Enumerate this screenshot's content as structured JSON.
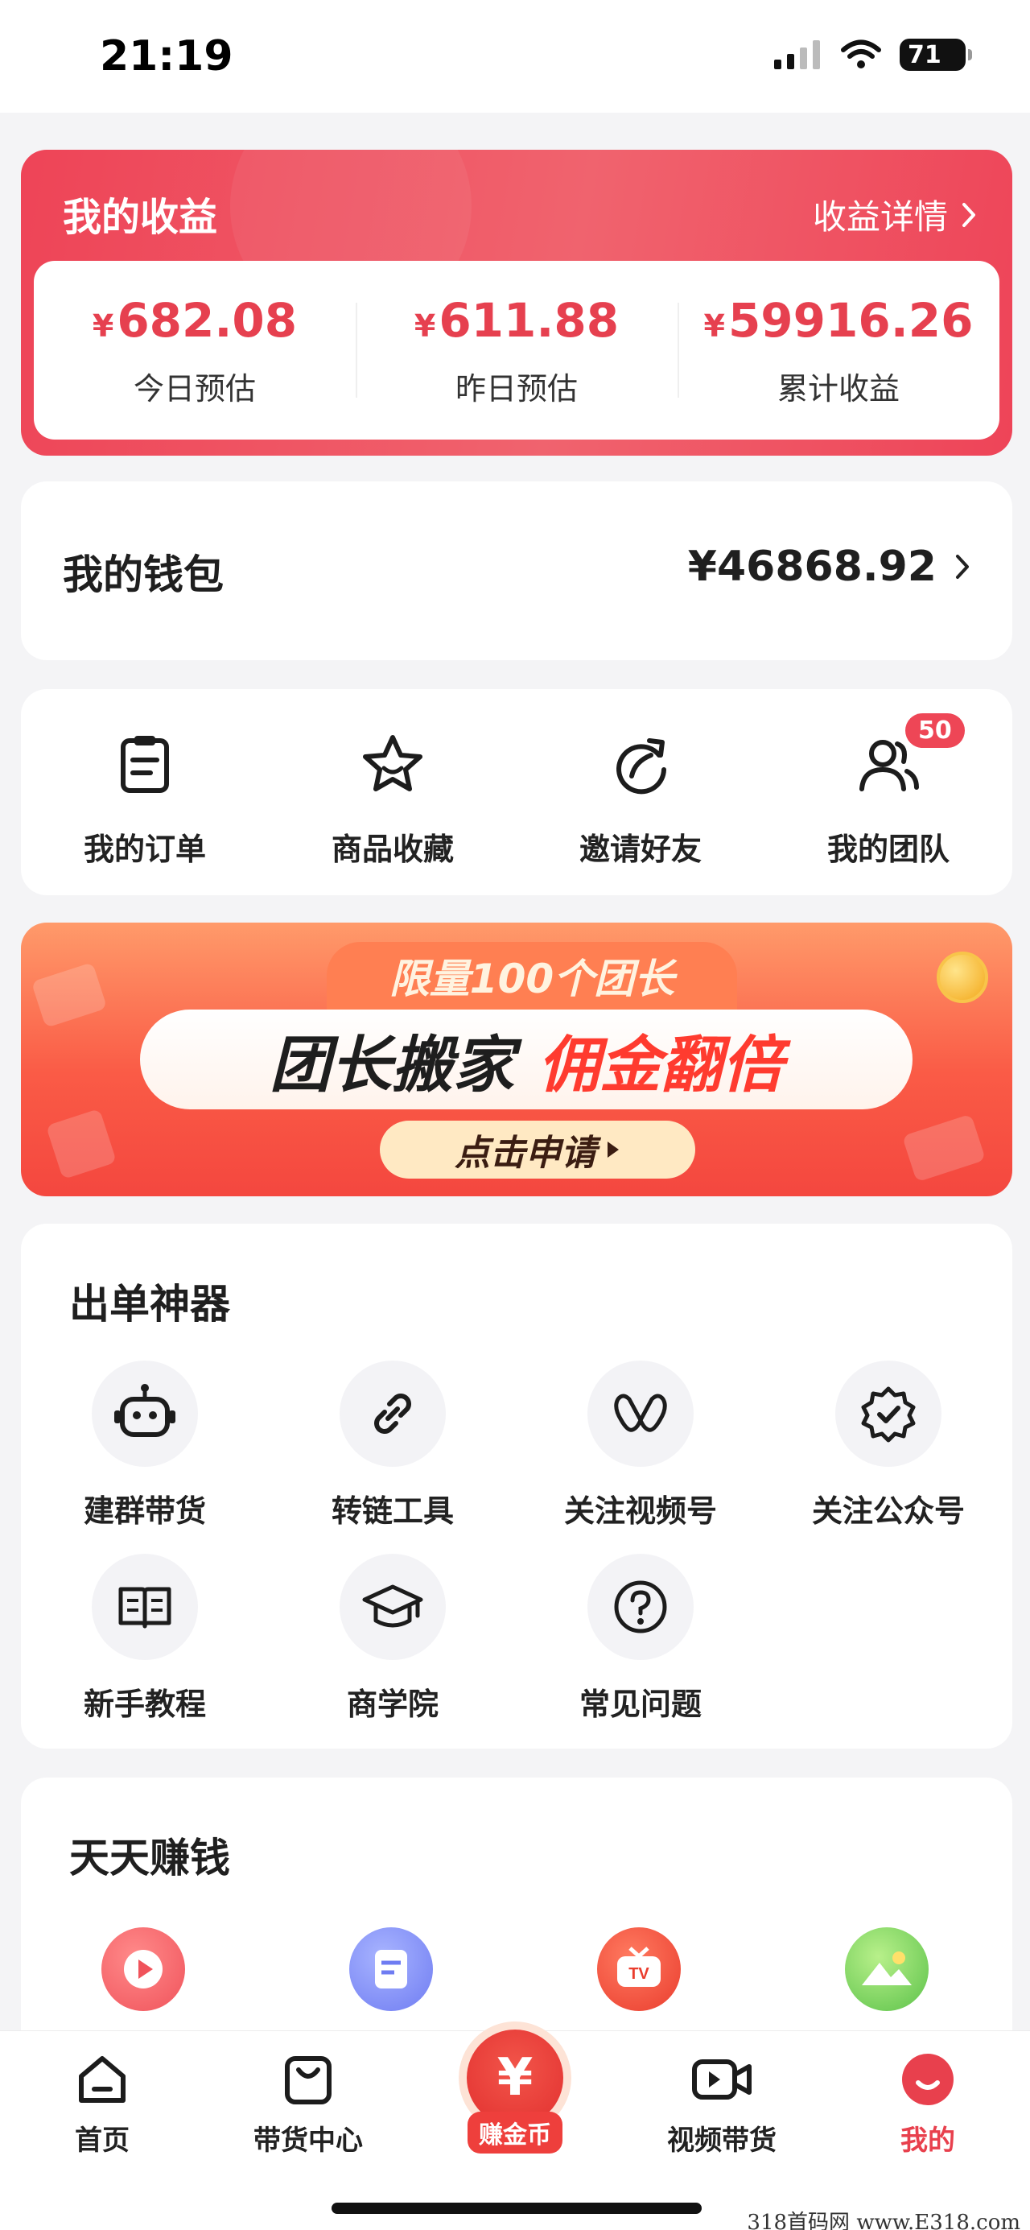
{
  "status_bar": {
    "time": "21:19",
    "battery": "71"
  },
  "earnings": {
    "title": "我的收益",
    "detail_link": "收益详情",
    "currency": "¥",
    "stats": [
      {
        "amount": "682.08",
        "label": "今日预估"
      },
      {
        "amount": "611.88",
        "label": "昨日预估"
      },
      {
        "amount": "59916.26",
        "label": "累计收益"
      }
    ]
  },
  "wallet": {
    "title": "我的钱包",
    "amount": "¥46868.92"
  },
  "quick_actions": [
    {
      "label": "我的订单",
      "icon": "order-icon"
    },
    {
      "label": "商品收藏",
      "icon": "star-icon"
    },
    {
      "label": "邀请好友",
      "icon": "invite-icon"
    },
    {
      "label": "我的团队",
      "icon": "team-icon",
      "badge": "50"
    }
  ],
  "banner": {
    "top": "限量100个团长",
    "main_a": "团长搬家",
    "main_b": "佣金翻倍",
    "button": "点击申请"
  },
  "tools": {
    "title": "出单神器",
    "items": [
      {
        "label": "建群带货",
        "icon": "robot-icon"
      },
      {
        "label": "转链工具",
        "icon": "link-icon"
      },
      {
        "label": "关注视频号",
        "icon": "video-channel-icon"
      },
      {
        "label": "关注公众号",
        "icon": "verified-icon"
      },
      {
        "label": "新手教程",
        "icon": "book-icon"
      },
      {
        "label": "商学院",
        "icon": "graduation-cap-icon"
      },
      {
        "label": "常见问题",
        "icon": "question-icon"
      }
    ]
  },
  "daily": {
    "title": "天天赚钱",
    "icons": [
      "play-icon",
      "note-icon",
      "tv-icon",
      "landscape-icon"
    ]
  },
  "tabbar": {
    "items": [
      {
        "label": "首页",
        "icon": "home-icon"
      },
      {
        "label": "带货中心",
        "icon": "bag-icon"
      },
      {
        "label": "赚金币",
        "icon": "coin-icon",
        "glyph": "¥"
      },
      {
        "label": "视频带货",
        "icon": "video-icon"
      },
      {
        "label": "我的",
        "icon": "profile-icon",
        "active": true
      }
    ]
  },
  "watermark": "318首码网 www.E318.com",
  "colors": {
    "accent": "#e8404d",
    "card": "#ffffff",
    "background": "#f4f4f6"
  }
}
